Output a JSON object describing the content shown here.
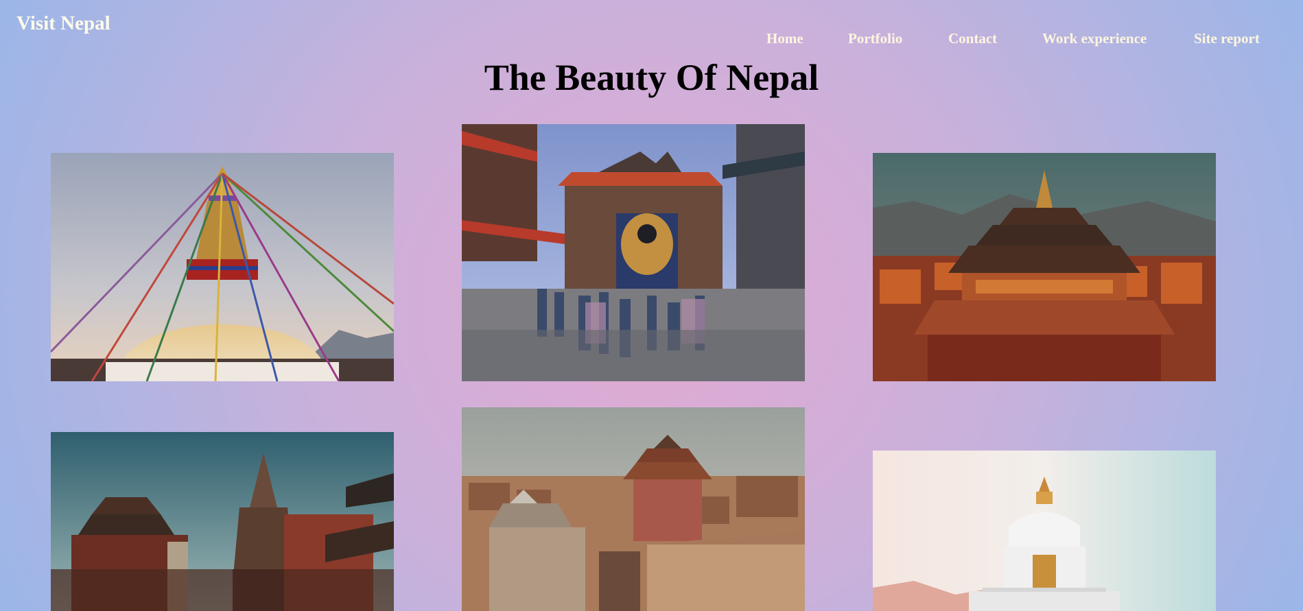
{
  "site": {
    "brand": "Visit Nepal"
  },
  "nav": {
    "items": [
      {
        "label": "Home"
      },
      {
        "label": "Portfolio"
      },
      {
        "label": "Contact"
      },
      {
        "label": "Work experience"
      },
      {
        "label": "Site report"
      }
    ]
  },
  "main": {
    "title": "The Beauty Of Nepal"
  },
  "gallery": {
    "images": [
      {
        "subject": "boudhanath-stupa-photo"
      },
      {
        "subject": "temple-square-crowd-photo"
      },
      {
        "subject": "pagoda-temple-sunset-photo"
      },
      {
        "subject": "durbar-square-temples-photo"
      },
      {
        "subject": "patan-city-rooftops-photo"
      },
      {
        "subject": "white-peace-pagoda-photo"
      }
    ]
  },
  "colors": {
    "background_center": "#e3a9d2",
    "background_edge": "#95b6ea",
    "nav_text": "#fff6df",
    "title_text": "#000000"
  }
}
